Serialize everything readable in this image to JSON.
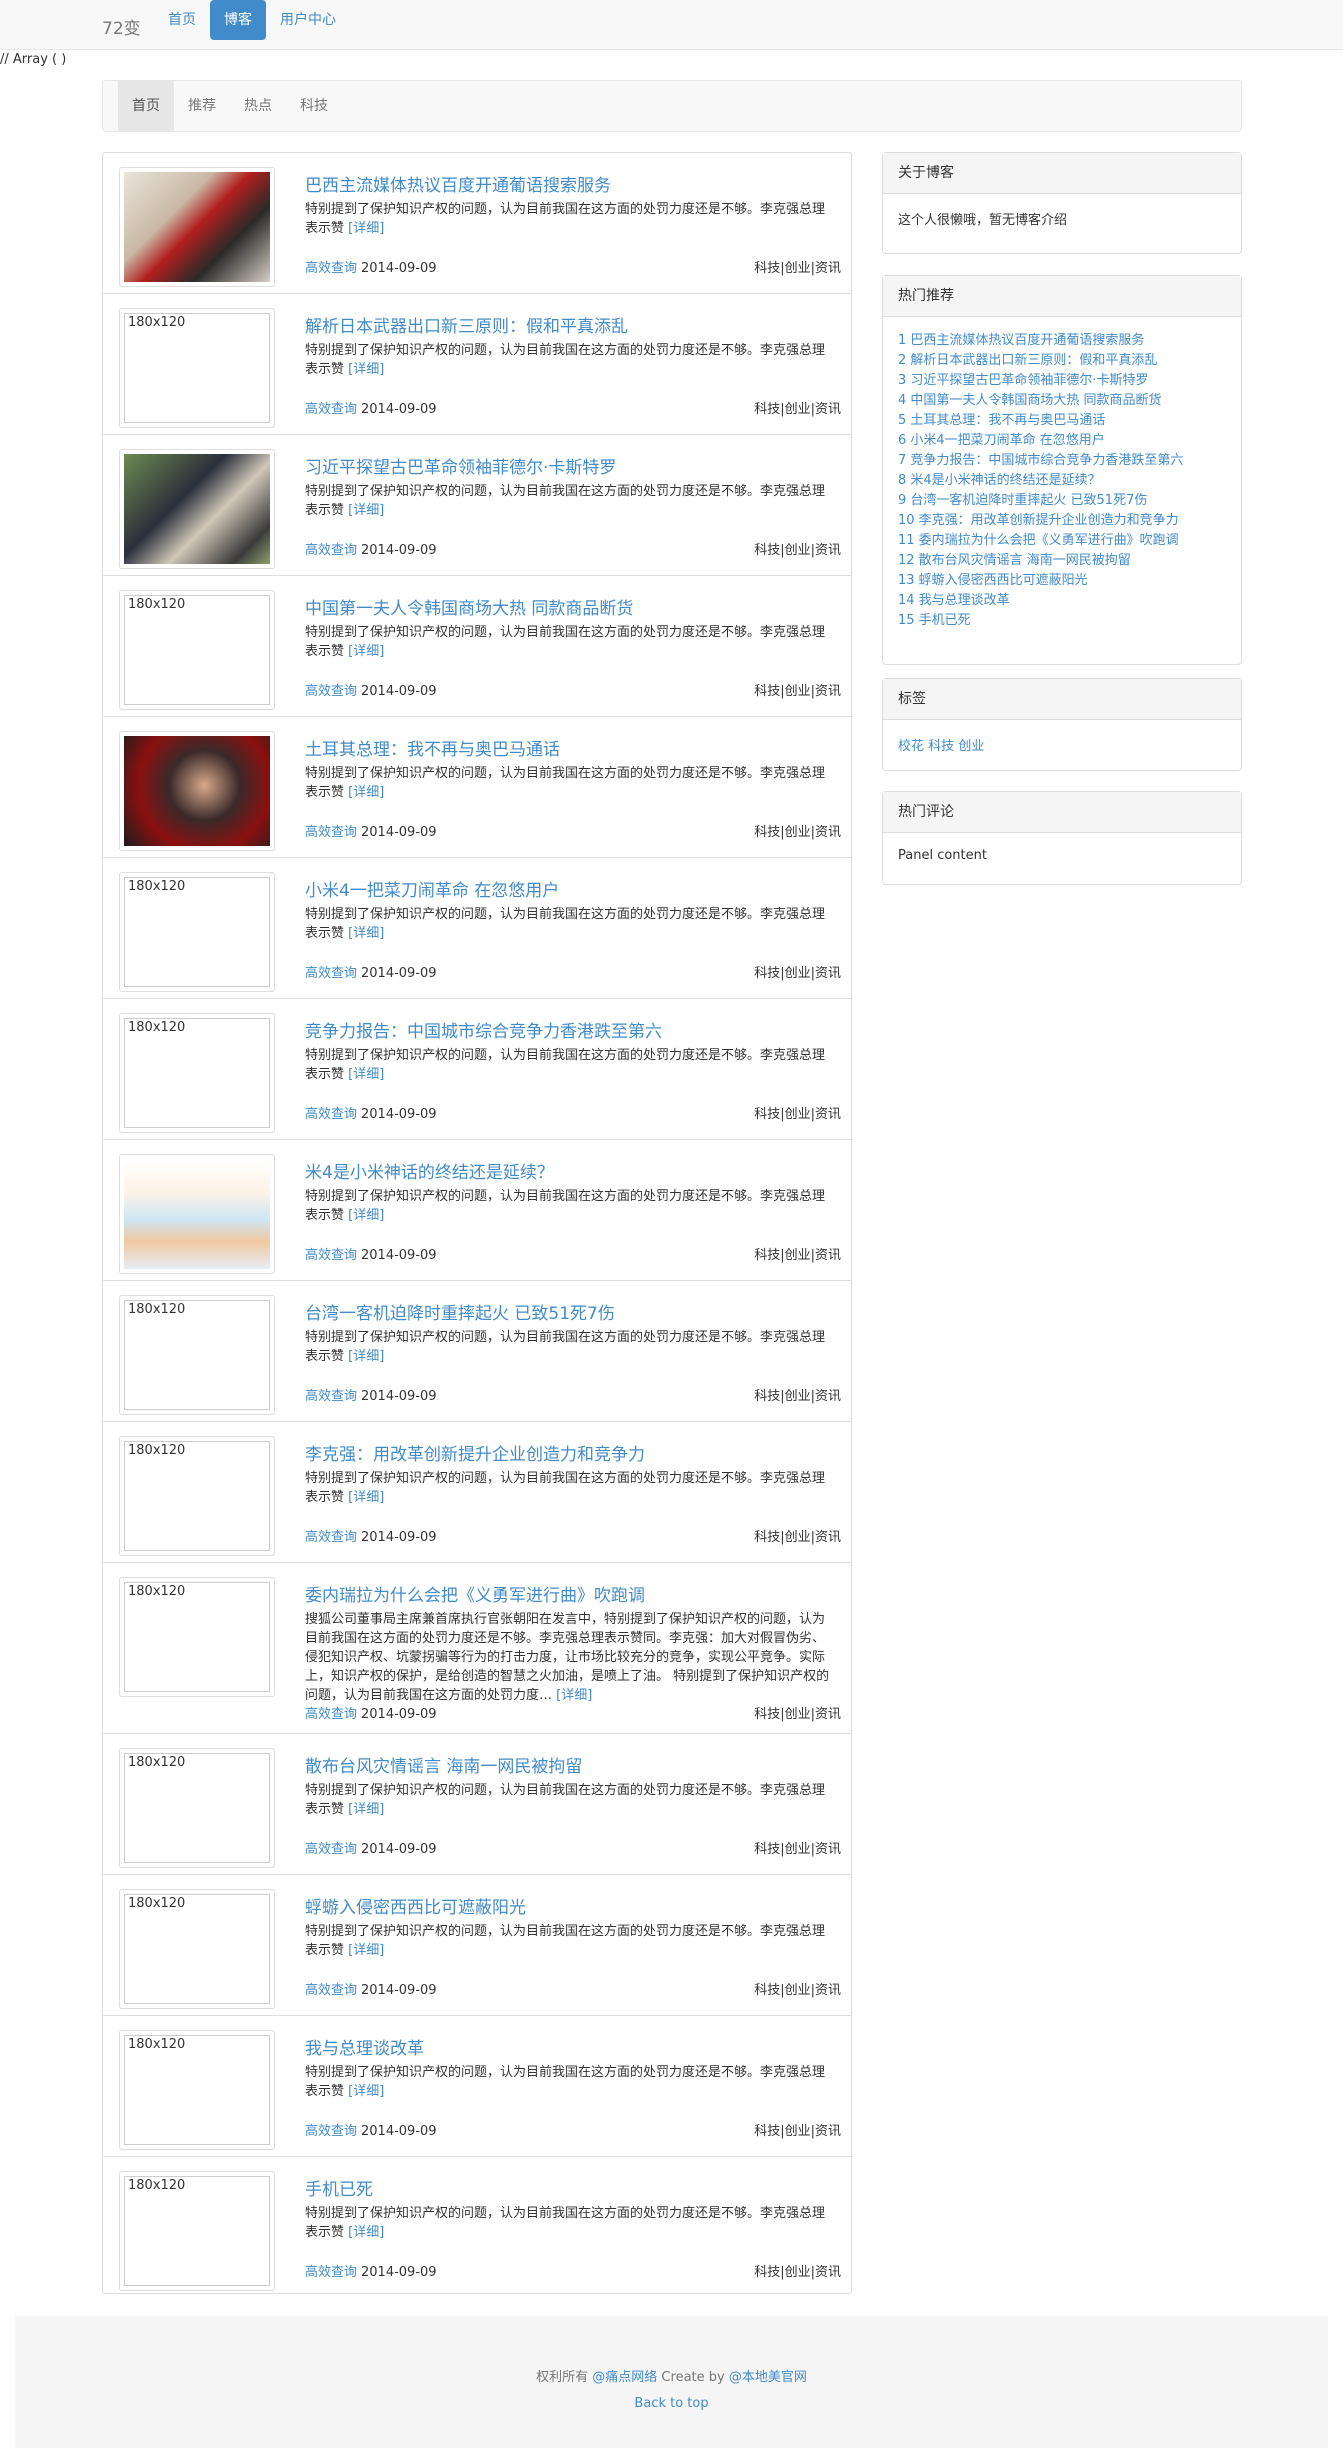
{
  "navbar": {
    "brand": "72变",
    "items": [
      {
        "label": "首页"
      },
      {
        "label": "博客"
      },
      {
        "label": "用户中心"
      }
    ]
  },
  "debug_text": "// Array ( )",
  "tabs": [
    {
      "label": "首页"
    },
    {
      "label": "推荐"
    },
    {
      "label": "热点"
    },
    {
      "label": "科技"
    }
  ],
  "placeholder_text": "180x120",
  "articles": [
    {
      "title": "巴西主流媒体热议百度开通葡语搜索服务",
      "summary": "特别提到了保护知识产权的问题，认为目前我国在这方面的处罚力度还是不够。李克强总理表示赞",
      "more": "[详细]",
      "author": "高效查询",
      "date": "2014-09-09",
      "category": "科技|创业|资讯",
      "image": "photo"
    },
    {
      "title": "解析日本武器出口新三原则：假和平真添乱",
      "summary": "特别提到了保护知识产权的问题，认为目前我国在这方面的处罚力度还是不够。李克强总理表示赞",
      "more": "[详细]",
      "author": "高效查询",
      "date": "2014-09-09",
      "category": "科技|创业|资讯",
      "image": "placeholder"
    },
    {
      "title": "习近平探望古巴革命领袖菲德尔·卡斯特罗",
      "summary": "特别提到了保护知识产权的问题，认为目前我国在这方面的处罚力度还是不够。李克强总理表示赞",
      "more": "[详细]",
      "author": "高效查询",
      "date": "2014-09-09",
      "category": "科技|创业|资讯",
      "image": "photo"
    },
    {
      "title": "中国第一夫人令韩国商场大热 同款商品断货",
      "summary": "特别提到了保护知识产权的问题，认为目前我国在这方面的处罚力度还是不够。李克强总理表示赞",
      "more": "[详细]",
      "author": "高效查询",
      "date": "2014-09-09",
      "category": "科技|创业|资讯",
      "image": "placeholder"
    },
    {
      "title": "土耳其总理：我不再与奥巴马通话",
      "summary": "特别提到了保护知识产权的问题，认为目前我国在这方面的处罚力度还是不够。李克强总理表示赞",
      "more": "[详细]",
      "author": "高效查询",
      "date": "2014-09-09",
      "category": "科技|创业|资讯",
      "image": "photo"
    },
    {
      "title": "小米4一把菜刀闹革命 在忽悠用户",
      "summary": "特别提到了保护知识产权的问题，认为目前我国在这方面的处罚力度还是不够。李克强总理表示赞",
      "more": "[详细]",
      "author": "高效查询",
      "date": "2014-09-09",
      "category": "科技|创业|资讯",
      "image": "placeholder"
    },
    {
      "title": "竞争力报告：中国城市综合竞争力香港跌至第六",
      "summary": "特别提到了保护知识产权的问题，认为目前我国在这方面的处罚力度还是不够。李克强总理表示赞",
      "more": "[详细]",
      "author": "高效查询",
      "date": "2014-09-09",
      "category": "科技|创业|资讯",
      "image": "placeholder"
    },
    {
      "title": "米4是小米神话的终结还是延续？",
      "summary": "特别提到了保护知识产权的问题，认为目前我国在这方面的处罚力度还是不够。李克强总理表示赞",
      "more": "[详细]",
      "author": "高效查询",
      "date": "2014-09-09",
      "category": "科技|创业|资讯",
      "image": "photo"
    },
    {
      "title": "台湾一客机迫降时重摔起火 已致51死7伤",
      "summary": "特别提到了保护知识产权的问题，认为目前我国在这方面的处罚力度还是不够。李克强总理表示赞",
      "more": "[详细]",
      "author": "高效查询",
      "date": "2014-09-09",
      "category": "科技|创业|资讯",
      "image": "placeholder"
    },
    {
      "title": "李克强：用改革创新提升企业创造力和竞争力",
      "summary": "特别提到了保护知识产权的问题，认为目前我国在这方面的处罚力度还是不够。李克强总理表示赞",
      "more": "[详细]",
      "author": "高效查询",
      "date": "2014-09-09",
      "category": "科技|创业|资讯",
      "image": "placeholder"
    },
    {
      "title": "委内瑞拉为什么会把《义勇军进行曲》吹跑调",
      "summary": "搜狐公司董事局主席兼首席执行官张朝阳在发言中，特别提到了保护知识产权的问题，认为目前我国在这方面的处罚力度还是不够。李克强总理表示赞同。李克强：加大对假冒伪劣、侵犯知识产权、坑蒙拐骗等行为的打击力度，让市场比较充分的竞争，实现公平竞争。实际上，知识产权的保护，是给创造的智慧之火加油，是喷上了油。 特别提到了保护知识产权的问题，认为目前我国在这方面的处罚力度…",
      "more": "[详细]",
      "author": "高效查询",
      "date": "2014-09-09",
      "category": "科技|创业|资讯",
      "image": "placeholder"
    },
    {
      "title": "散布台风灾情谣言 海南一网民被拘留",
      "summary": "特别提到了保护知识产权的问题，认为目前我国在这方面的处罚力度还是不够。李克强总理表示赞",
      "more": "[详细]",
      "author": "高效查询",
      "date": "2014-09-09",
      "category": "科技|创业|资讯",
      "image": "placeholder"
    },
    {
      "title": "蜉蝣入侵密西西比可遮蔽阳光",
      "summary": "特别提到了保护知识产权的问题，认为目前我国在这方面的处罚力度还是不够。李克强总理表示赞",
      "more": "[详细]",
      "author": "高效查询",
      "date": "2014-09-09",
      "category": "科技|创业|资讯",
      "image": "placeholder"
    },
    {
      "title": "我与总理谈改革",
      "summary": "特别提到了保护知识产权的问题，认为目前我国在这方面的处罚力度还是不够。李克强总理表示赞",
      "more": "[详细]",
      "author": "高效查询",
      "date": "2014-09-09",
      "category": "科技|创业|资讯",
      "image": "placeholder"
    },
    {
      "title": "手机已死",
      "summary": "特别提到了保护知识产权的问题，认为目前我国在这方面的处罚力度还是不够。李克强总理表示赞",
      "more": "[详细]",
      "author": "高效查询",
      "date": "2014-09-09",
      "category": "科技|创业|资讯",
      "image": "placeholder"
    }
  ],
  "sidebar": {
    "about": {
      "title": "关于博客",
      "content": "这个人很懒哦，暂无博客介绍"
    },
    "hot": {
      "title": "热门推荐",
      "items": [
        "1 巴西主流媒体热议百度开通葡语搜索服务",
        "2 解析日本武器出口新三原则：假和平真添乱",
        "3 习近平探望古巴革命领袖菲德尔·卡斯特罗",
        "4 中国第一夫人令韩国商场大热 同款商品断货",
        "5 土耳其总理：我不再与奥巴马通话",
        "6 小米4一把菜刀闹革命 在忽悠用户",
        "7 竞争力报告：中国城市综合竞争力香港跌至第六",
        "8 米4是小米神话的终结还是延续？",
        "9 台湾一客机迫降时重摔起火 已致51死7伤",
        "10 李克强：用改革创新提升企业创造力和竞争力",
        "11 委内瑞拉为什么会把《义勇军进行曲》吹跑调",
        "12 散布台风灾情谣言 海南一网民被拘留",
        "13 蜉蝣入侵密西西比可遮蔽阳光",
        "14 我与总理谈改革",
        "15 手机已死"
      ]
    },
    "tags": {
      "title": "标签",
      "items": [
        "校花",
        "科技",
        "创业"
      ]
    },
    "comments": {
      "title": "热门评论",
      "content": "Panel content"
    }
  },
  "footer": {
    "prefix": "权利所有 ",
    "company": "@痛点网络",
    "middle": " Create by ",
    "author": "@本地美官网",
    "back_to_top": "Back to top"
  },
  "colors": {
    "link": "#428bca",
    "active_nav": "#428bca",
    "border": "#dddddd",
    "panel_head": "#f5f5f5"
  }
}
